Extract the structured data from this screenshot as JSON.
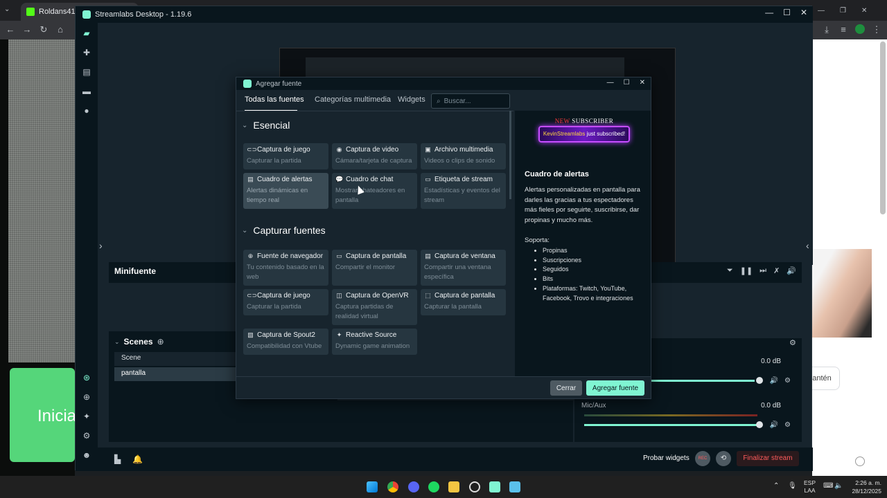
{
  "browser": {
    "tab_title": "Roldans41 Video",
    "page_left_text": "Inicia",
    "page_right_button": "antén"
  },
  "app": {
    "title": "Streamlabs Desktop - 1.19.6",
    "minifuente": "Minifuente",
    "scenes_title": "Scenes",
    "scene_items": [
      "Scene",
      "pantalla"
    ],
    "mixer": [
      {
        "label": "",
        "db": "0.0 dB"
      },
      {
        "label": "Mic/Aux",
        "db": "0.0 dB"
      }
    ],
    "footer": {
      "test_widgets": "Probar widgets",
      "rec": "REC",
      "end_stream": "Finalizar stream"
    }
  },
  "modal": {
    "title": "Agregar fuente",
    "tabs": [
      "Todas las fuentes",
      "Categorías multimedia",
      "Widgets"
    ],
    "search_placeholder": "Buscar...",
    "sections": [
      {
        "title": "Esencial",
        "cards": [
          {
            "icon": "gamepad-icon",
            "title": "Captura de juego",
            "desc": "Capturar la partida"
          },
          {
            "icon": "webcam-icon",
            "title": "Captura de video",
            "desc": "Cámara/tarjeta de captura"
          },
          {
            "icon": "film-icon",
            "title": "Archivo multimedia",
            "desc": "Videos o clips de sonido"
          },
          {
            "icon": "alert-box-icon",
            "title": "Cuadro de alertas",
            "desc": "Alertas dinámicas en tiempo real"
          },
          {
            "icon": "chat-icon",
            "title": "Cuadro de chat",
            "desc": "Mostrar chateadores en pantalla"
          },
          {
            "icon": "label-icon",
            "title": "Etiqueta de stream",
            "desc": "Estadísticas y eventos del stream"
          }
        ]
      },
      {
        "title": "Capturar fuentes",
        "cards": [
          {
            "icon": "globe-icon",
            "title": "Fuente de navegador",
            "desc": "Tu contenido basado en la web"
          },
          {
            "icon": "monitor-icon",
            "title": "Captura de pantalla",
            "desc": "Compartir el monitor"
          },
          {
            "icon": "window-icon",
            "title": "Captura de ventana",
            "desc": "Compartir una ventana específica"
          },
          {
            "icon": "gamepad-icon",
            "title": "Captura de juego",
            "desc": "Capturar la partida"
          },
          {
            "icon": "vr-icon",
            "title": "Captura de OpenVR",
            "desc": "Captura partidas de realidad virtual"
          },
          {
            "icon": "screen-region-icon",
            "title": "Captura de pantalla",
            "desc": "Capturar la pantalla"
          },
          {
            "icon": "spout-icon",
            "title": "Captura de Spout2",
            "desc": "Compatibilidad con Vtube"
          },
          {
            "icon": "sparkle-icon",
            "title": "Reactive Source",
            "desc": "Dynamic game animation"
          }
        ]
      }
    ],
    "preview": {
      "banner_new": "NEW",
      "banner_subscriber": "SUBSCRIBER",
      "banner_name": "KevinStreamlabs",
      "banner_action": "just subscribed!",
      "title": "Cuadro de alertas",
      "description": "Alertas personalizadas en pantalla para darles las gracias a tus espectadores más fieles por seguirte, suscribirse, dar propinas y mucho más.",
      "supports_label": "Soporta:",
      "supports": [
        "Propinas",
        "Suscripciones",
        "Seguidos",
        "Bits",
        "Plataformas: Twitch, YouTube, Facebook, Trovo e integraciones"
      ]
    },
    "cancel": "Cerrar",
    "add": "Agregar fuente"
  },
  "taskbar": {
    "lang": "ESP",
    "lang2": "LAA",
    "time": "2:26 a. m.",
    "date": "28/12/2025"
  }
}
